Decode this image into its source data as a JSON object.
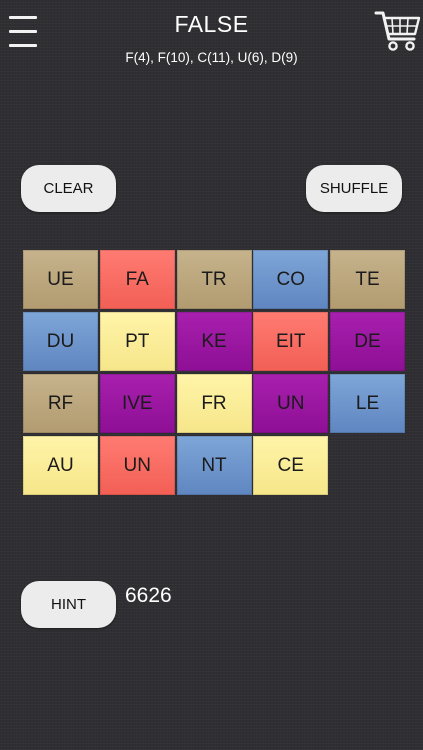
{
  "header": {
    "title": "FALSE",
    "subtitle": "F(4), F(10), C(11), U(6), D(9)"
  },
  "buttons": {
    "clear_label": "CLEAR",
    "shuffle_label": "SHUFFLE",
    "hint_label": "HINT"
  },
  "score": "6626",
  "colors": {
    "tan": "#bca67d",
    "red": "#f86b61",
    "blue": "#6e96cc",
    "purple": "#9c18a2",
    "yellow": "#fbee98"
  },
  "icons": {
    "menu": "hamburger-menu-icon",
    "cart": "shopping-cart-icon"
  },
  "grid": {
    "rows": [
      [
        {
          "text": "UE",
          "color": "tan"
        },
        {
          "text": "FA",
          "color": "red"
        },
        {
          "text": "TR",
          "color": "tan"
        },
        {
          "text": "CO",
          "color": "blue"
        },
        {
          "text": "TE",
          "color": "tan"
        }
      ],
      [
        {
          "text": "DU",
          "color": "blue"
        },
        {
          "text": "PT",
          "color": "yellow"
        },
        {
          "text": "KE",
          "color": "purple"
        },
        {
          "text": "EIT",
          "color": "red"
        },
        {
          "text": "DE",
          "color": "purple"
        }
      ],
      [
        {
          "text": "RF",
          "color": "tan"
        },
        {
          "text": "IVE",
          "color": "purple"
        },
        {
          "text": "FR",
          "color": "yellow"
        },
        {
          "text": "UN",
          "color": "purple"
        },
        {
          "text": "LE",
          "color": "blue"
        }
      ],
      [
        {
          "text": "AU",
          "color": "yellow"
        },
        {
          "text": "UN",
          "color": "red"
        },
        {
          "text": "NT",
          "color": "blue"
        },
        {
          "text": "CE",
          "color": "yellow"
        }
      ]
    ]
  }
}
